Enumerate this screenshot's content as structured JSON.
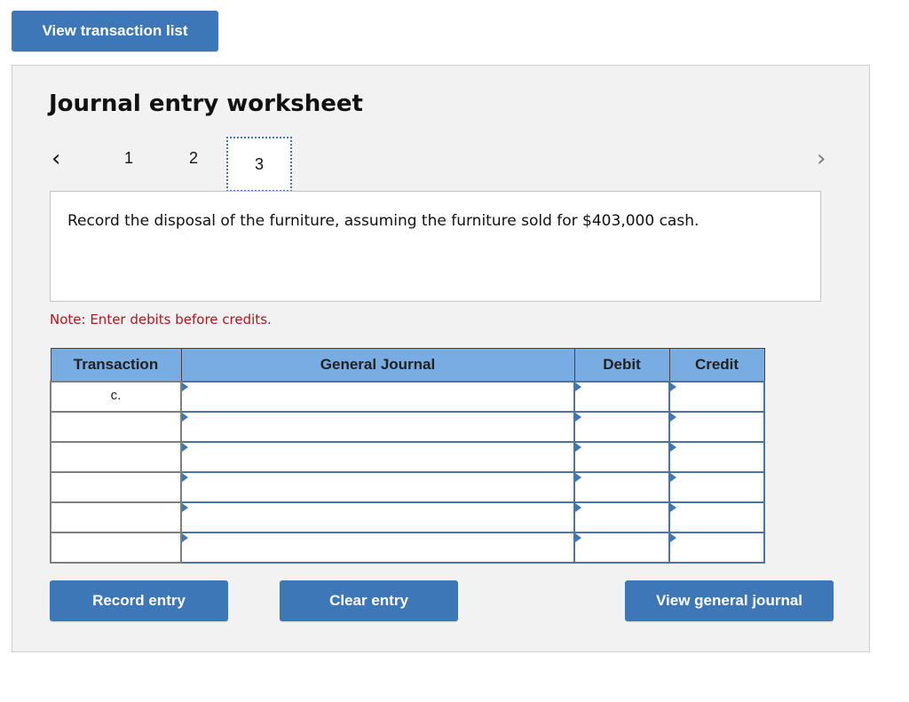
{
  "header": {
    "view_transaction_list": "View transaction list"
  },
  "worksheet": {
    "title": "Journal entry worksheet",
    "nav": {
      "prev_icon": "‹",
      "next_icon": "›",
      "tabs": [
        "1",
        "2",
        "3"
      ],
      "active_tab": "3"
    },
    "prompt": "Record the disposal of the furniture, assuming the furniture sold for $403,000 cash.",
    "note": "Note: Enter debits before credits.",
    "table": {
      "columns": [
        "Transaction",
        "General Journal",
        "Debit",
        "Credit"
      ],
      "rows": [
        {
          "transaction": "c.",
          "account": "",
          "debit": "",
          "credit": ""
        },
        {
          "transaction": "",
          "account": "",
          "debit": "",
          "credit": ""
        },
        {
          "transaction": "",
          "account": "",
          "debit": "",
          "credit": ""
        },
        {
          "transaction": "",
          "account": "",
          "debit": "",
          "credit": ""
        },
        {
          "transaction": "",
          "account": "",
          "debit": "",
          "credit": ""
        },
        {
          "transaction": "",
          "account": "",
          "debit": "",
          "credit": ""
        }
      ]
    },
    "buttons": {
      "record_entry": "Record entry",
      "clear_entry": "Clear entry",
      "view_general_journal": "View general journal"
    }
  },
  "colors": {
    "button": "#3d77b8",
    "table_header": "#79ace3",
    "note": "#b0161d"
  }
}
